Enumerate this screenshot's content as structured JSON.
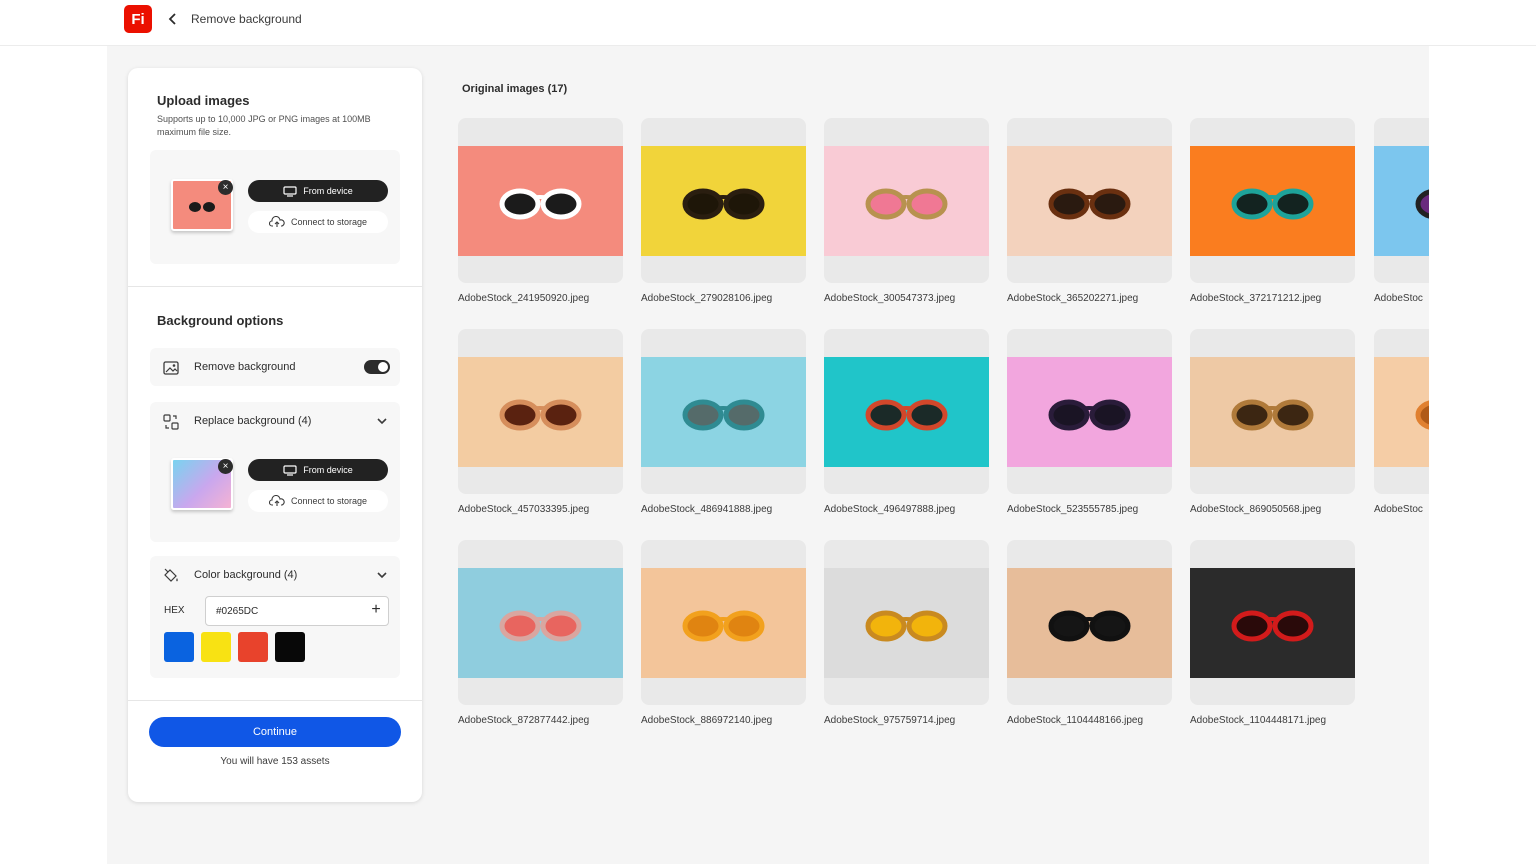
{
  "header": {
    "logo": "Fi",
    "title": "Remove background"
  },
  "upload": {
    "title": "Upload images",
    "subtitle": "Supports up to 10,000 JPG or PNG images at 100MB maximum file size.",
    "from_device": "From device",
    "connect_storage": "Connect to storage"
  },
  "background": {
    "title": "Background options",
    "remove_label": "Remove background",
    "replace_label": "Replace background (4)",
    "from_device": "From device",
    "connect_storage": "Connect to storage",
    "color_label": "Color background (4)",
    "hex_label": "HEX",
    "hex_value": "#0265DC",
    "swatches": [
      "#0a63e0",
      "#f8e213",
      "#e8432c",
      "#080808"
    ]
  },
  "footer": {
    "continue_label": "Continue",
    "assets_note": "You will have 153 assets"
  },
  "grid": {
    "title": "Original images (17)",
    "images": [
      {
        "name": "AdobeStock_241950920.jpeg",
        "bg": "#f48b7d",
        "frame": "#ffffff",
        "lens": "#1b1b1b"
      },
      {
        "name": "AdobeStock_279028106.jpeg",
        "bg": "#f1d43a",
        "frame": "#2a1e10",
        "lens": "#1e1608"
      },
      {
        "name": "AdobeStock_300547373.jpeg",
        "bg": "#f9cbd5",
        "frame": "#b8924f",
        "lens": "#f07894"
      },
      {
        "name": "AdobeStock_365202271.jpeg",
        "bg": "#f3d2bd",
        "frame": "#6a3010",
        "lens": "#2a1a10"
      },
      {
        "name": "AdobeStock_372171212.jpeg",
        "bg": "#fa7d1f",
        "frame": "#1ea39a",
        "lens": "#132320"
      },
      {
        "name": "AdobeStock_457033395.jpeg",
        "bg": "#f3cca2",
        "frame": "#d68e5c",
        "lens": "#5a2210"
      },
      {
        "name": "AdobeStock_486941888.jpeg",
        "bg": "#8cd4e3",
        "frame": "#2f8b92",
        "lens": "#556b6a"
      },
      {
        "name": "AdobeStock_496497888.jpeg",
        "bg": "#20c5c9",
        "frame": "#d2472b",
        "lens": "#1b2a28"
      },
      {
        "name": "AdobeStock_523555785.jpeg",
        "bg": "#f2a6de",
        "frame": "#2a1c3a",
        "lens": "#1a1424"
      },
      {
        "name": "AdobeStock_869050568.jpeg",
        "bg": "#eec9a5",
        "frame": "#b07a3a",
        "lens": "#3c2612"
      },
      {
        "name": "AdobeStock_872877442.jpeg",
        "bg": "#8fcdde",
        "frame": "#d9a6a0",
        "lens": "#e8655f"
      },
      {
        "name": "AdobeStock_886972140.jpeg",
        "bg": "#f3c59a",
        "frame": "#f2a11d",
        "lens": "#e08411"
      },
      {
        "name": "AdobeStock_975759714.jpeg",
        "bg": "#dcdcdc",
        "frame": "#c98a20",
        "lens": "#f2b40c"
      },
      {
        "name": "AdobeStock_1104448166.jpeg",
        "bg": "#e7bd9a",
        "frame": "#111111",
        "lens": "#151515"
      },
      {
        "name": "AdobeStock_1104448171.jpeg",
        "bg": "#2b2b2b",
        "frame": "#d21b1b",
        "lens": "#2a0a0a"
      },
      {
        "name": "AdobeStoc",
        "bg": "#7cc6ee",
        "frame": "#222222",
        "lens": "#6a2a7e"
      },
      {
        "name": "AdobeStoc",
        "bg": "#f5cda6",
        "frame": "#e08030",
        "lens": "#b05a18"
      }
    ]
  }
}
